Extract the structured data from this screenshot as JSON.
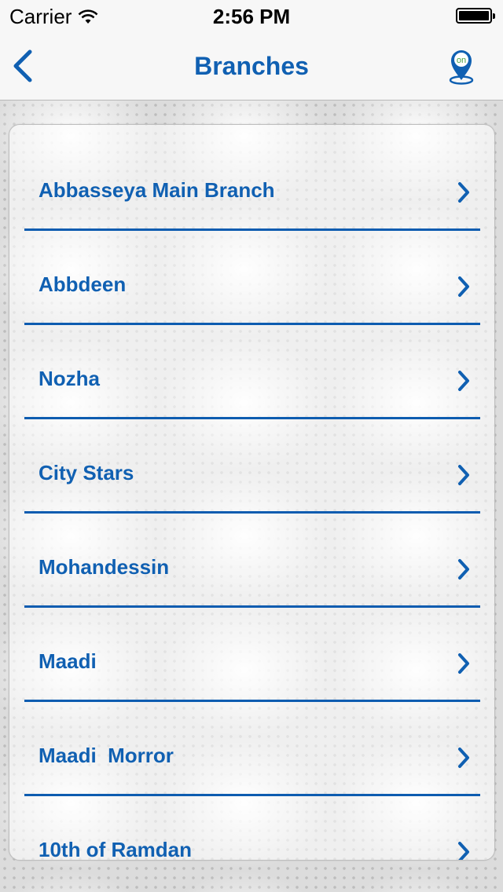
{
  "status_bar": {
    "carrier": "Carrier",
    "time": "2:56 PM"
  },
  "nav": {
    "title": "Branches",
    "location_badge": "on"
  },
  "branches": [
    {
      "label": "Abbasseya Main Branch"
    },
    {
      "label": "Abbdeen"
    },
    {
      "label": "Nozha"
    },
    {
      "label": "City Stars"
    },
    {
      "label": "Mohandessin"
    },
    {
      "label": "Maadi"
    },
    {
      "label": "Maadi  Morror"
    },
    {
      "label": "10th of Ramdan"
    }
  ],
  "colors": {
    "accent": "#1060b2",
    "separator": "#0d5cb0",
    "badge": "#4aa040"
  }
}
